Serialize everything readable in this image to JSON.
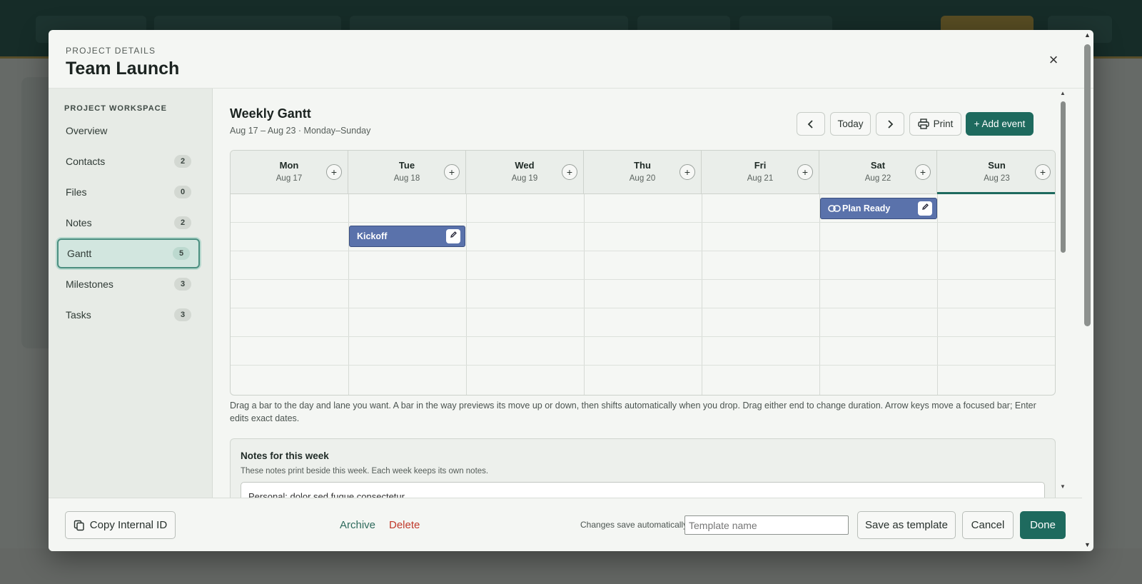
{
  "modal": {
    "eyebrow": "PROJECT DETAILS",
    "title": "Team Launch",
    "close_glyph": "×"
  },
  "sidebar": {
    "heading": "PROJECT WORKSPACE",
    "items": [
      {
        "label": "Overview",
        "count": null
      },
      {
        "label": "Contacts",
        "count": "2"
      },
      {
        "label": "Files",
        "count": "0"
      },
      {
        "label": "Notes",
        "count": "2"
      },
      {
        "label": "Gantt",
        "count": "5",
        "active": true
      },
      {
        "label": "Milestones",
        "count": "3"
      },
      {
        "label": "Tasks",
        "count": "3"
      }
    ]
  },
  "gantt": {
    "title": "Weekly Gantt",
    "subtitle": "Aug 17 – Aug 23 · Monday–Sunday",
    "toolbar": {
      "prev_glyph": "‹",
      "today_label": "Today",
      "next_glyph": "›",
      "print_label": "Print",
      "add_event_label": "+ Add event"
    },
    "days": [
      {
        "name": "Mon",
        "date": "Aug 17"
      },
      {
        "name": "Tue",
        "date": "Aug 18"
      },
      {
        "name": "Wed",
        "date": "Aug 19"
      },
      {
        "name": "Thu",
        "date": "Aug 20"
      },
      {
        "name": "Fri",
        "date": "Aug 21"
      },
      {
        "name": "Sat",
        "date": "Aug 22"
      },
      {
        "name": "Sun",
        "date": "Aug 23",
        "today": true
      }
    ],
    "add_glyph": "+",
    "bars": [
      {
        "label": "Plan Ready",
        "day": "Sat",
        "lane": 1,
        "linked": true
      },
      {
        "label": "Kickoff",
        "day": "Tue",
        "lane": 2,
        "linked": false
      }
    ],
    "help": "Drag a bar to the day and lane you want. A bar in the way previews its move up or down, then shifts automatically when you drop. Drag either end to change duration. Arrow keys move a focused bar; Enter edits exact dates."
  },
  "notes": {
    "title": "Notes for this week",
    "subtitle": "These notes print beside this week. Each week keeps its own notes.",
    "value": "Personal: dolor sed fugue consectetur"
  },
  "footer": {
    "copy_id_label": "Copy Internal ID",
    "archive_label": "Archive",
    "delete_label": "Delete",
    "autosave_note": "Changes save automatically",
    "template_placeholder": "Template name",
    "save_template_label": "Save as template",
    "cancel_label": "Cancel",
    "done_label": "Done"
  },
  "colors": {
    "accent": "#1e6a5e",
    "bar": "#5a72ab",
    "delete": "#c0392b",
    "archive": "#2e6a5c"
  }
}
